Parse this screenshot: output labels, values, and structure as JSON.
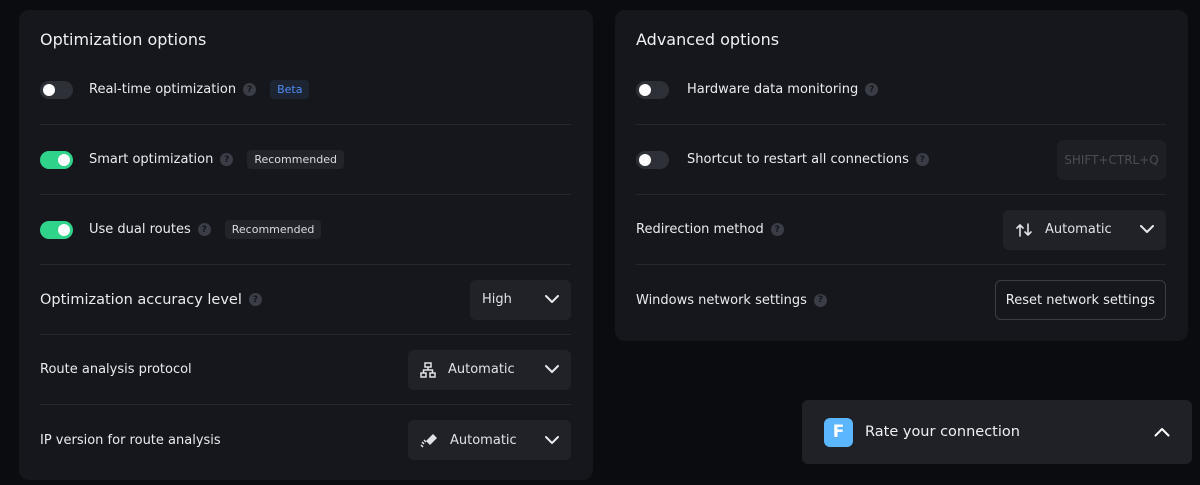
{
  "optimization": {
    "title": "Optimization options",
    "realtime": {
      "label": "Real-time optimization",
      "badge": "Beta",
      "enabled": false
    },
    "smart": {
      "label": "Smart optimization",
      "badge": "Recommended",
      "enabled": true
    },
    "dual": {
      "label": "Use dual routes",
      "badge": "Recommended",
      "enabled": true
    },
    "accuracy": {
      "label": "Optimization accuracy level",
      "value": "High"
    },
    "protocol": {
      "label": "Route analysis protocol",
      "value": "Automatic",
      "icon": "network-icon"
    },
    "ip_version": {
      "label": "IP version for route analysis",
      "value": "Automatic",
      "icon": "route-ip-icon"
    }
  },
  "advanced": {
    "title": "Advanced options",
    "hardware": {
      "label": "Hardware data monitoring",
      "enabled": false
    },
    "shortcut": {
      "label": "Shortcut to restart all connections",
      "enabled": false,
      "keys": "SHIFT+CTRL+Q"
    },
    "redirection": {
      "label": "Redirection method",
      "value": "Automatic",
      "icon": "swap-arrows-icon"
    },
    "windows": {
      "label": "Windows network settings",
      "button": "Reset network settings"
    }
  },
  "rate": {
    "text": "Rate your connection",
    "logo_letter": "F"
  },
  "colors": {
    "toggle_on": "#2fd38a",
    "beta": "#4f8cf7",
    "logo": "#5bb6ff"
  }
}
